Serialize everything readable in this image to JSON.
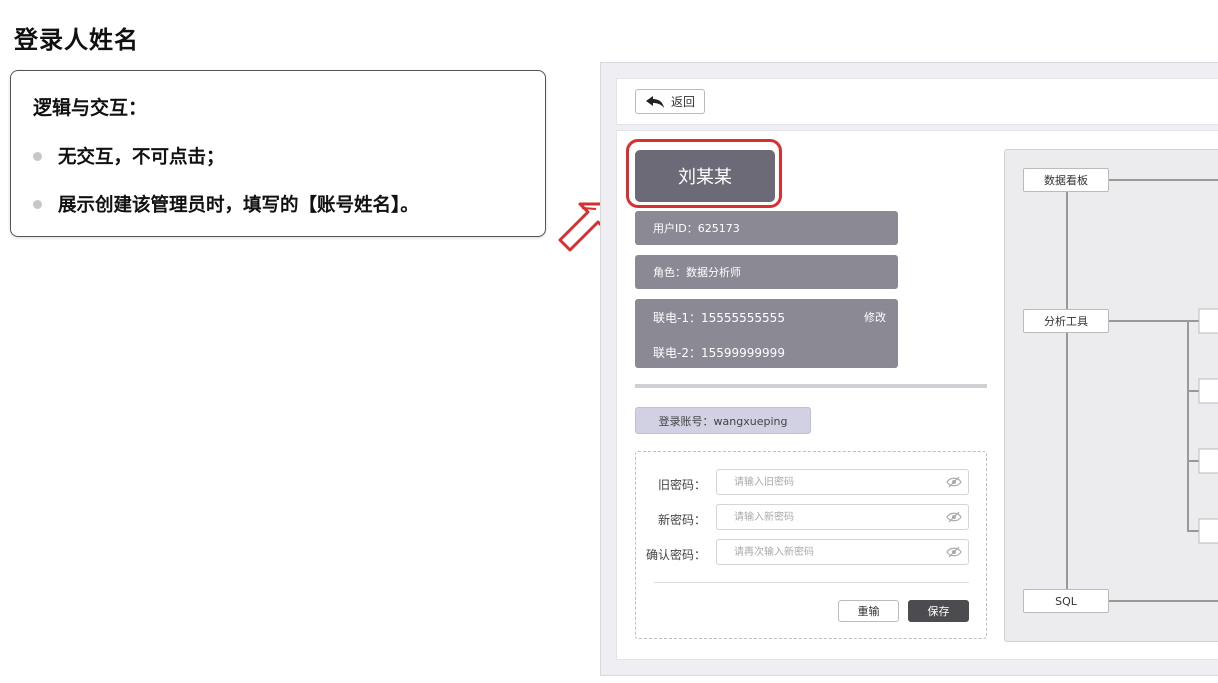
{
  "page_title": "登录人姓名",
  "note": {
    "heading": "逻辑与交互：",
    "items": [
      "无交互，不可点击；",
      "展示创建该管理员时，填写的【账号姓名】。"
    ]
  },
  "topbar": {
    "back_label": "返回"
  },
  "profile": {
    "name": "刘某某",
    "user_id": "用户ID：625173",
    "role": "角色：数据分析师",
    "phone1": "联电-1：15555555555",
    "phone2": "联电-2：15599999999",
    "edit_label": "修改",
    "login_account": "登录账号：wangxueping"
  },
  "password_form": {
    "old_label": "旧密码：",
    "old_placeholder": "请输入旧密码",
    "new_label": "新密码：",
    "new_placeholder": "请输入新密码",
    "confirm_label": "确认密码：",
    "confirm_placeholder": "请再次输入新密码",
    "reset_label": "重输",
    "save_label": "保存"
  },
  "tree": {
    "nodes": [
      "数据看板",
      "分析工具",
      "SQL"
    ]
  },
  "colors": {
    "highlight": "#d92f2f",
    "name_card": "#6b6a76",
    "info_row": "#8a8994",
    "save_button": "#4c4c50"
  }
}
